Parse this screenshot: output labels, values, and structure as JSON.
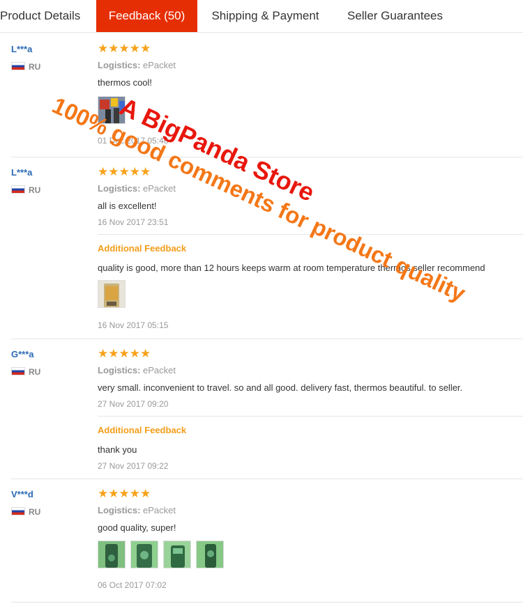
{
  "tabs": [
    {
      "label": "Product Details"
    },
    {
      "label": "Feedback (50)"
    },
    {
      "label": "Shipping & Payment"
    },
    {
      "label": "Seller Guarantees"
    }
  ],
  "rating_stars": "★★★★★",
  "logistics_label": "Logistics:",
  "additional_label": "Additional Feedback",
  "reviews": [
    {
      "user": "L***a",
      "country": "RU",
      "logistics": "ePacket",
      "text": "thermos cool!",
      "date": "01 Dec 2017 05:48"
    },
    {
      "user": "L***a",
      "country": "RU",
      "logistics": "ePacket",
      "text": "all is excellent!",
      "date": "16 Nov 2017 23:51",
      "additional": {
        "text": "quality is good, more than 12 hours keeps warm at room temperature thermos seller recommend",
        "date": "16 Nov 2017 05:15"
      }
    },
    {
      "user": "G***a",
      "country": "RU",
      "logistics": "ePacket",
      "text": "very small. inconvenient to travel. so and all good. delivery fast, thermos beautiful. to seller.",
      "date": "27 Nov 2017 09:20",
      "additional": {
        "text": "thank you",
        "date": "27 Nov 2017 09:22"
      }
    },
    {
      "user": "V***d",
      "country": "RU",
      "logistics": "ePacket",
      "text": "good quality, super!",
      "date": "06 Oct 2017 07:02"
    }
  ],
  "watermark": {
    "line1": "A BigPanda Store",
    "line2": "100% good comments for product quality"
  }
}
